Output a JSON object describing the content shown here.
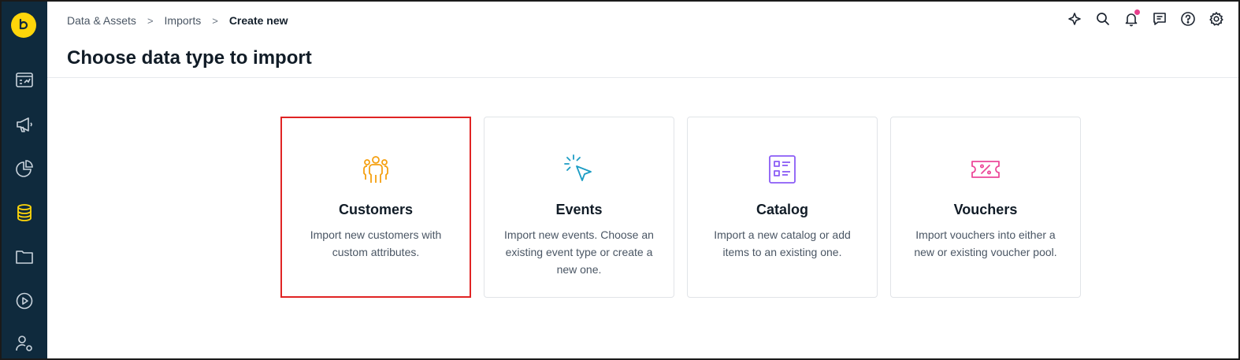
{
  "breadcrumb": {
    "items": [
      "Data & Assets",
      "Imports"
    ],
    "current": "Create new"
  },
  "page": {
    "title": "Choose data type to import"
  },
  "sidebar": {
    "logo_letter": "b",
    "items": [
      {
        "icon": "dashboard-icon"
      },
      {
        "icon": "megaphone-icon"
      },
      {
        "icon": "pie-chart-icon"
      },
      {
        "icon": "database-icon",
        "active": true
      },
      {
        "icon": "folder-icon"
      },
      {
        "icon": "play-circle-icon"
      },
      {
        "icon": "user-settings-icon"
      }
    ]
  },
  "top_icons": [
    "sparkle-icon",
    "search-icon",
    "bell-icon",
    "chat-icon",
    "help-icon",
    "gear-icon"
  ],
  "cards": [
    {
      "title": "Customers",
      "desc": "Import new customers with custom attributes.",
      "icon": "customers-icon",
      "color": "#f5a011",
      "selected": true
    },
    {
      "title": "Events",
      "desc": "Import new events. Choose an existing event type or create a new one.",
      "icon": "pointer-click-icon",
      "color": "#1b9cc4"
    },
    {
      "title": "Catalog",
      "desc": "Import a new catalog or add items to an existing one.",
      "icon": "catalog-icon",
      "color": "#8b5cf6"
    },
    {
      "title": "Vouchers",
      "desc": "Import vouchers into either a new or existing voucher pool.",
      "icon": "voucher-icon",
      "color": "#ec4899"
    }
  ],
  "colors": {
    "sidebar_bg": "#0f2a3d",
    "accent": "#ffd60a",
    "selection": "#e02424"
  }
}
